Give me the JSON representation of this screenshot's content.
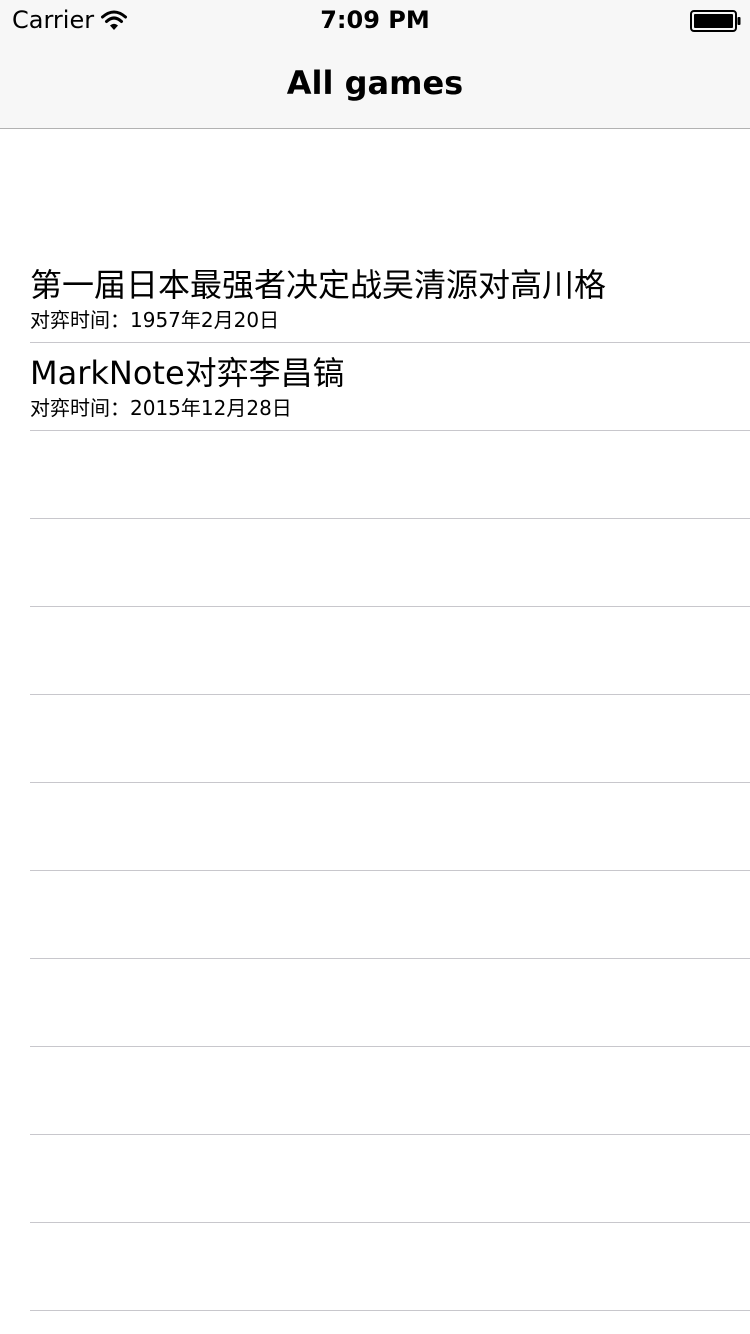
{
  "status_bar": {
    "carrier": "Carrier",
    "time": "7:09 PM",
    "wifi_icon": "wifi-icon",
    "battery_icon": "battery-full-icon"
  },
  "nav": {
    "title": "All games"
  },
  "games": [
    {
      "title": "第一届日本最强者决定战吴清源对高川格",
      "date": "对弈时间：1957年2月20日"
    },
    {
      "title": "MarkNote对弈李昌镐",
      "date": "对弈时间：2015年12月28日"
    }
  ],
  "empty_rows": 10,
  "colors": {
    "bar_background": "#f7f7f7",
    "separator": "#c8c7cc",
    "text": "#000000"
  }
}
